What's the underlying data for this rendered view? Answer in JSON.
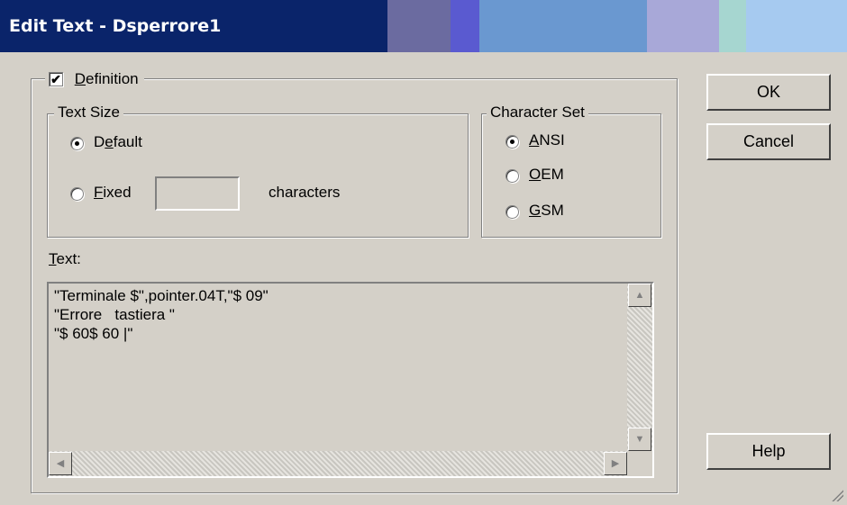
{
  "window": {
    "title": "Edit Text - Dsperrore1"
  },
  "definition": {
    "label": "Definition",
    "mnemonic": "D",
    "rest": "efinition",
    "checked": true,
    "check_glyph": "✔"
  },
  "text_size": {
    "legend": "Text Size",
    "default_option": {
      "pre": "D",
      "mnemonic": "e",
      "post": "fault",
      "selected": true
    },
    "fixed_option": {
      "mnemonic": "F",
      "post": "ixed",
      "selected": false
    },
    "fixed_value": "",
    "characters_label": "characters"
  },
  "character_set": {
    "legend": "Character Set",
    "options": [
      {
        "mnemonic": "A",
        "post": "NSI",
        "selected": true
      },
      {
        "mnemonic": "O",
        "post": "EM",
        "selected": false
      },
      {
        "mnemonic": "G",
        "post": "SM",
        "selected": false
      }
    ]
  },
  "text_field": {
    "label_mnemonic": "T",
    "label_post": "ext:",
    "lines": [
      "\"Terminale $\",pointer.04T,\"$ 09\"",
      "\"Errore   tastiera \"",
      "\"$ 60$ 60 |\""
    ]
  },
  "buttons": {
    "ok": "OK",
    "cancel": "Cancel",
    "help": "Help"
  },
  "icons": {
    "scroll_up": "▲",
    "scroll_down": "▼",
    "scroll_left": "◀",
    "scroll_right": "▶"
  },
  "colors": {
    "titlebar": "#0a246a",
    "face": "#d4d0c8"
  }
}
